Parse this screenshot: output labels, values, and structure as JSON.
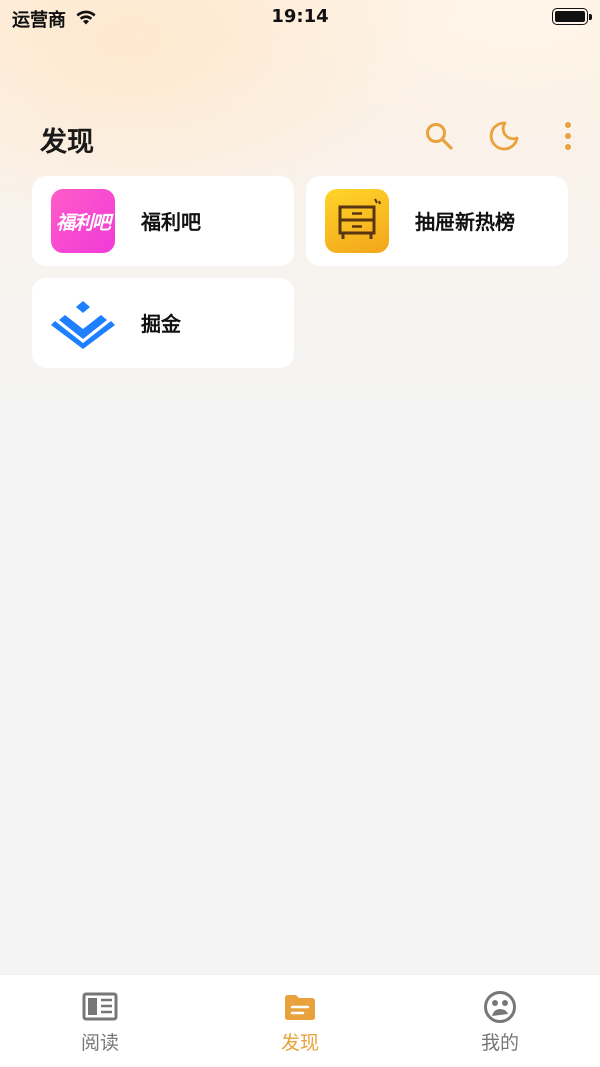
{
  "status_bar": {
    "carrier": "运营商",
    "time": "19:14"
  },
  "header": {
    "title": "发现",
    "icons": [
      "search-icon",
      "moon-icon",
      "more-vertical-icon"
    ]
  },
  "cards": [
    {
      "label": "福利吧",
      "icon": "fuliba-logo",
      "icon_text": "福利吧",
      "icon_color": "#f53fd3"
    },
    {
      "label": "抽屉新热榜",
      "icon": "drawer-icon",
      "icon_color": "#f7b91f"
    },
    {
      "label": "掘金",
      "icon": "juejin-logo",
      "icon_color": "#1e80ff"
    }
  ],
  "tabbar": {
    "tabs": [
      {
        "label": "阅读",
        "icon": "book-icon",
        "active": false
      },
      {
        "label": "发现",
        "icon": "folder-icon",
        "active": true
      },
      {
        "label": "我的",
        "icon": "face-icon",
        "active": false
      }
    ]
  },
  "colors": {
    "accent": "#e9a23b",
    "inactive": "#777777",
    "card_bg": "#ffffff",
    "page_bg": "#f4f4f4"
  }
}
